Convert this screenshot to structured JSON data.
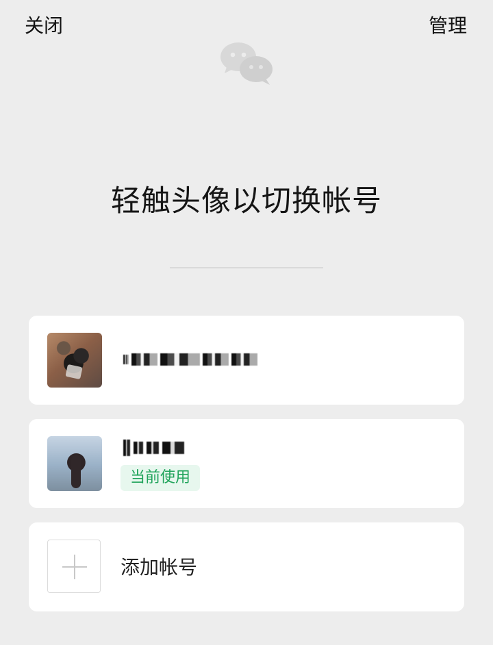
{
  "header": {
    "left_label": "关闭",
    "right_label": "管理",
    "logo_icon": "wechat-logo-icon"
  },
  "main": {
    "title": "轻触头像以切换帐号",
    "accounts": [
      {
        "avatar_icon": "user-photo-dog-icon",
        "name_display": "masked",
        "current_badge": ""
      },
      {
        "avatar_icon": "user-photo-person-icon",
        "name_display": "masked",
        "current_badge": "当前使用"
      }
    ],
    "add_account": {
      "label": "添加帐号",
      "icon": "plus-icon"
    }
  },
  "colors": {
    "background": "#ededed",
    "card": "#ffffff",
    "accent_green": "#1fa35a",
    "badge_bg": "#e7f7ee"
  }
}
